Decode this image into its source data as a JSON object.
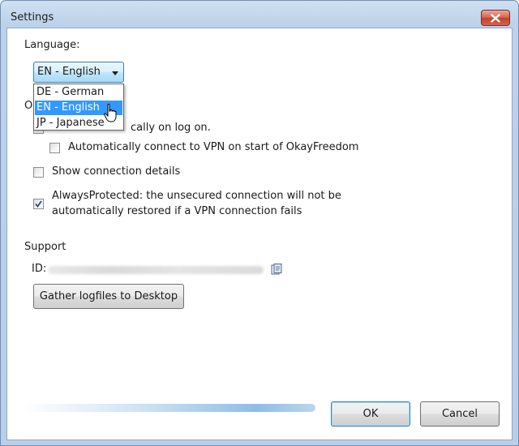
{
  "window": {
    "title": "Settings"
  },
  "language": {
    "section_label": "Language:",
    "selected": "EN - English",
    "options": [
      "DE - German",
      "EN - English",
      "JP - Japanese"
    ]
  },
  "options": {
    "section_label_visible": "O",
    "start_on_logon": {
      "label_visible": "cally on log on.",
      "checked": false
    },
    "auto_connect": {
      "label": "Automatically connect to VPN on start of OkayFreedom",
      "checked": false
    },
    "show_details": {
      "label": "Show connection details",
      "checked": false
    },
    "always_protected": {
      "label_line1": "AlwaysProtected: the unsecured connection will not be",
      "label_line2": "automatically restored if a VPN connection fails",
      "checked": true
    }
  },
  "support": {
    "section_label": "Support",
    "id_label": "ID:",
    "gather_button": "Gather logfiles to Desktop"
  },
  "buttons": {
    "ok": "OK",
    "cancel": "Cancel"
  },
  "colors": {
    "selection": "#3399ff",
    "close": "#c4412a"
  }
}
